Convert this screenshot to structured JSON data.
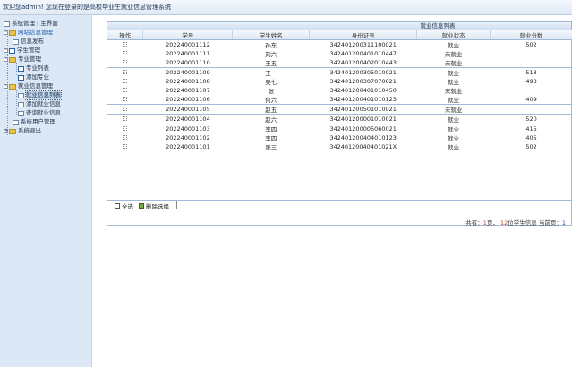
{
  "header": {
    "title": "欢迎您admin! 您现在登录的是高校毕业生就业信息管理系统"
  },
  "sidebar": {
    "top_links": [
      "系统管理",
      "主界面"
    ],
    "items": [
      {
        "label": "网站信息管理",
        "level": 0,
        "type": "folder-open"
      },
      {
        "label": "信息发布",
        "level": 1,
        "type": "page"
      },
      {
        "label": "学生管理",
        "level": 0,
        "type": "folder-open"
      },
      {
        "label": "专业管理",
        "level": 0,
        "type": "folder-open"
      },
      {
        "label": "专业列表",
        "level": 1,
        "type": "page"
      },
      {
        "label": "添加专业",
        "level": 1,
        "type": "page"
      },
      {
        "label": "就业信息管理",
        "level": 0,
        "type": "folder-open"
      },
      {
        "label": "就业信息列表",
        "level": 1,
        "type": "page",
        "selected": true
      },
      {
        "label": "添加就业信息",
        "level": 1,
        "type": "page"
      },
      {
        "label": "查询就业信息",
        "level": 1,
        "type": "page"
      },
      {
        "label": "系统用户管理",
        "level": 0,
        "type": "page"
      },
      {
        "label": "系统退出",
        "level": 0,
        "type": "folder"
      }
    ]
  },
  "panel": {
    "title": "就业信息列表",
    "columns": [
      "操作",
      "学号",
      "学生姓名",
      "身份证号",
      "就业状态",
      "就业分数"
    ],
    "rows": [
      {
        "no": "202240001112",
        "name": "孙东",
        "id": "342401200311100021",
        "status": "就业",
        "score": "502",
        "group_start": true
      },
      {
        "no": "202240001111",
        "name": "刘六",
        "id": "342401200401010447",
        "status": "未就业",
        "score": ""
      },
      {
        "no": "202240001110",
        "name": "王五",
        "id": "342401200402010443",
        "status": "未就业",
        "score": ""
      },
      {
        "no": "202240001109",
        "name": "王一",
        "id": "342401200305010021",
        "status": "就业",
        "score": "513",
        "group_start": true
      },
      {
        "no": "202240001108",
        "name": "吴七",
        "id": "342401200307070021",
        "status": "就业",
        "score": "493"
      },
      {
        "no": "202240001107",
        "name": "张",
        "id": "342401200401010450",
        "status": "未就业",
        "score": ""
      },
      {
        "no": "202240001106",
        "name": "何六",
        "id": "342401200401010123",
        "status": "就业",
        "score": "409"
      },
      {
        "no": "202240001105",
        "name": "赵五",
        "id": "342401200501010021",
        "status": "未就业",
        "score": "",
        "group_start": true
      },
      {
        "no": "202240001104",
        "name": "赵六",
        "id": "342401200001010021",
        "status": "就业",
        "score": "520",
        "group_start": true
      },
      {
        "no": "202240001103",
        "name": "李四",
        "id": "342401200005060021",
        "status": "就业",
        "score": "415",
        "group_start": true
      },
      {
        "no": "202240001102",
        "name": "李四",
        "id": "342401200404010123",
        "status": "就业",
        "score": "405"
      },
      {
        "no": "202240001101",
        "name": "张三",
        "id": "34240120040401021X",
        "status": "就业",
        "score": "502"
      }
    ]
  },
  "toolbar": {
    "select_all": "全选",
    "delete": "删除选择"
  },
  "pager": {
    "prefix": "共有：",
    "pages": "1",
    "pages_suffix": "页，",
    "count": "12",
    "count_suffix": "位学生信息",
    "current_prefix": "当前页：",
    "current": "1"
  }
}
